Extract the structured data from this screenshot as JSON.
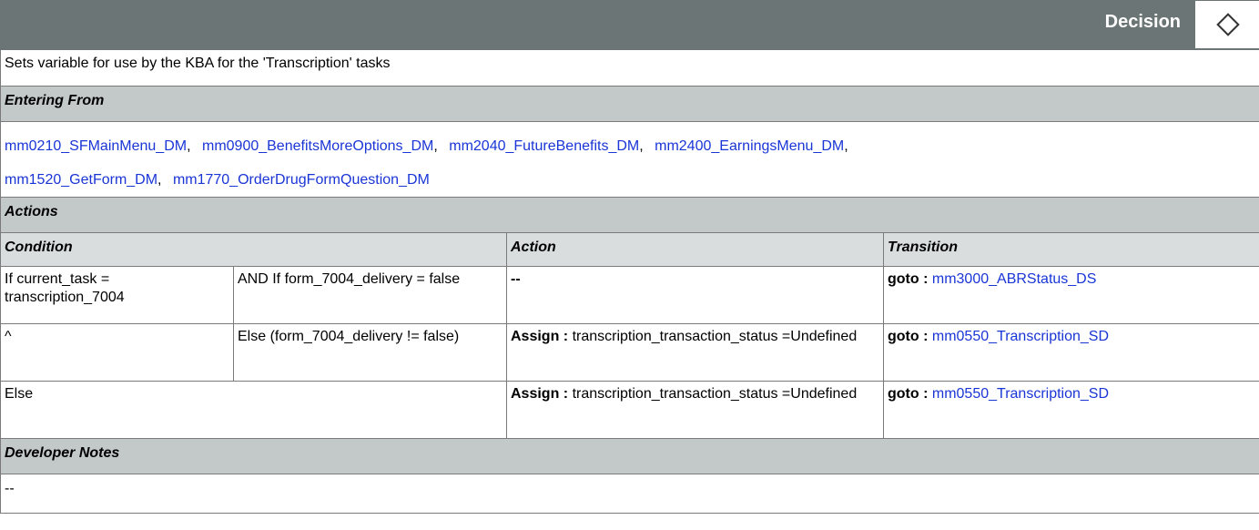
{
  "header": {
    "node_type": "Decision",
    "icon": "diamond-icon"
  },
  "description": "Sets variable for use by the KBA for the 'Transcription' tasks",
  "entering_from": {
    "title": "Entering From",
    "links": [
      "mm0210_SFMainMenu_DM",
      "mm0900_BenefitsMoreOptions_DM",
      "mm2040_FutureBenefits_DM",
      "mm2400_EarningsMenu_DM",
      "mm1520_GetForm_DM",
      "mm1770_OrderDrugFormQuestion_DM"
    ]
  },
  "actions": {
    "title": "Actions",
    "columns": {
      "condition": "Condition",
      "action": "Action",
      "transition": "Transition"
    },
    "rows": [
      {
        "cond1": "If current_task = transcription_7004",
        "cond2": "AND If form_7004_delivery = false",
        "action_prefix": "--",
        "action_text": "",
        "goto_label": "goto :",
        "goto_target": "mm3000_ABRStatus_DS"
      },
      {
        "cond1": "^",
        "cond2": "Else (form_7004_delivery != false)",
        "action_prefix": "Assign :",
        "action_text": "transcription_transaction_status =Undefined",
        "goto_label": "goto :",
        "goto_target": "mm0550_Transcription_SD"
      },
      {
        "cond1": "Else",
        "action_prefix": "Assign :",
        "action_text": "transcription_transaction_status =Undefined",
        "goto_label": "goto :",
        "goto_target": "mm0550_Transcription_SD"
      }
    ]
  },
  "developer_notes": {
    "title": "Developer Notes",
    "text": "--"
  }
}
